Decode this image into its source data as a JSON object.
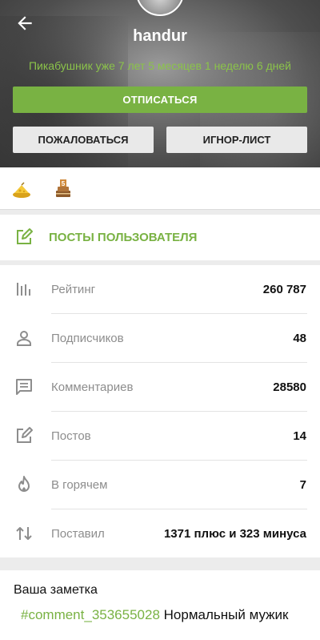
{
  "profile": {
    "username": "handur",
    "since": "Пикабушник уже 7 лет 5 месяцев 1 неделю 6 дней"
  },
  "actions": {
    "unsubscribe": "ОТПИСАТЬСЯ",
    "report": "ПОЖАЛОВАТЬСЯ",
    "ignore": "ИГНОР-ЛИСТ"
  },
  "awards": [
    {
      "icon": "cheese-award-icon"
    },
    {
      "icon": "five-years-cake-award-icon",
      "badge": "5"
    }
  ],
  "posts_link": {
    "label": "ПОСТЫ ПОЛЬЗОВАТЕЛЯ",
    "icon": "edit-icon"
  },
  "stats": [
    {
      "icon": "rating-icon",
      "label": "Рейтинг",
      "value": "260 787"
    },
    {
      "icon": "person-icon",
      "label": "Подписчиков",
      "value": "48"
    },
    {
      "icon": "comment-icon",
      "label": "Комментариев",
      "value": "28580"
    },
    {
      "icon": "edit-icon",
      "label": "Постов",
      "value": "14"
    },
    {
      "icon": "fire-icon",
      "label": "В горячем",
      "value": "7"
    },
    {
      "icon": "sort-arrows-icon",
      "label": "Поставил",
      "value": "1371 плюс и 323 минуса"
    }
  ],
  "note": {
    "title": "Ваша заметка",
    "link": "#comment_353655028",
    "text": " Нормальный мужик"
  },
  "colors": {
    "accent": "#79b243",
    "accent_text": "#8bc34a",
    "muted": "#8d8d8d"
  }
}
